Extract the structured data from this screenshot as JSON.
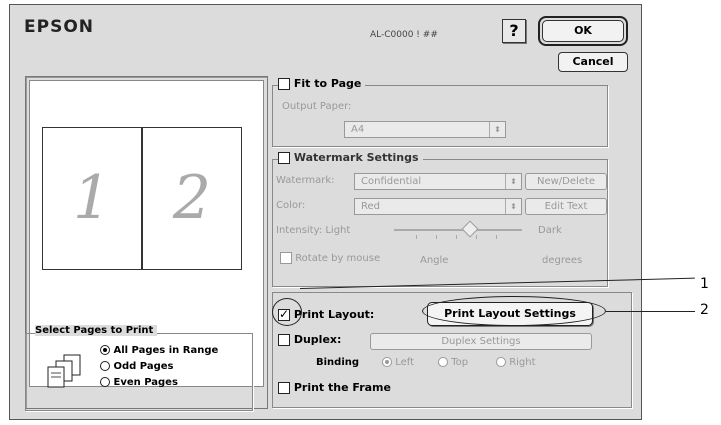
{
  "header": {
    "brand": "EPSON",
    "model": "AL-C0000 ! ##",
    "help_label": "?",
    "ok_label": "OK",
    "cancel_label": "Cancel"
  },
  "preview": {
    "page_numbers": [
      "1",
      "2"
    ]
  },
  "fit_to_page": {
    "label": "Fit to Page",
    "checked": false,
    "output_paper_label": "Output Paper:",
    "output_paper_value": "A4"
  },
  "watermark": {
    "label": "Watermark Settings",
    "checked": false,
    "watermark_label": "Watermark:",
    "watermark_value": "Confidential",
    "new_delete_label": "New/Delete",
    "color_label": "Color:",
    "color_value": "Red",
    "edit_text_label": "Edit Text",
    "intensity_label": "Intensity: Light",
    "intensity_dark_label": "Dark",
    "intensity_level": 0.6,
    "rotate_label": "Rotate by mouse",
    "angle_label": "Angle",
    "degrees_label": "degrees"
  },
  "print_layout": {
    "label": "Print Layout:",
    "checked": true,
    "settings_button_label": "Print Layout Settings"
  },
  "duplex": {
    "label": "Duplex:",
    "checked": false,
    "settings_button_label": "Duplex Settings",
    "binding_label": "Binding",
    "binding_options": [
      "Left",
      "Top",
      "Right"
    ],
    "binding_selected": "Left"
  },
  "print_frame": {
    "label": "Print the Frame",
    "checked": false
  },
  "select_pages": {
    "title": "Select Pages to Print",
    "options": [
      "All Pages in Range",
      "Odd Pages",
      "Even Pages"
    ],
    "selected": "All Pages in Range"
  },
  "callouts": [
    "1",
    "2"
  ]
}
